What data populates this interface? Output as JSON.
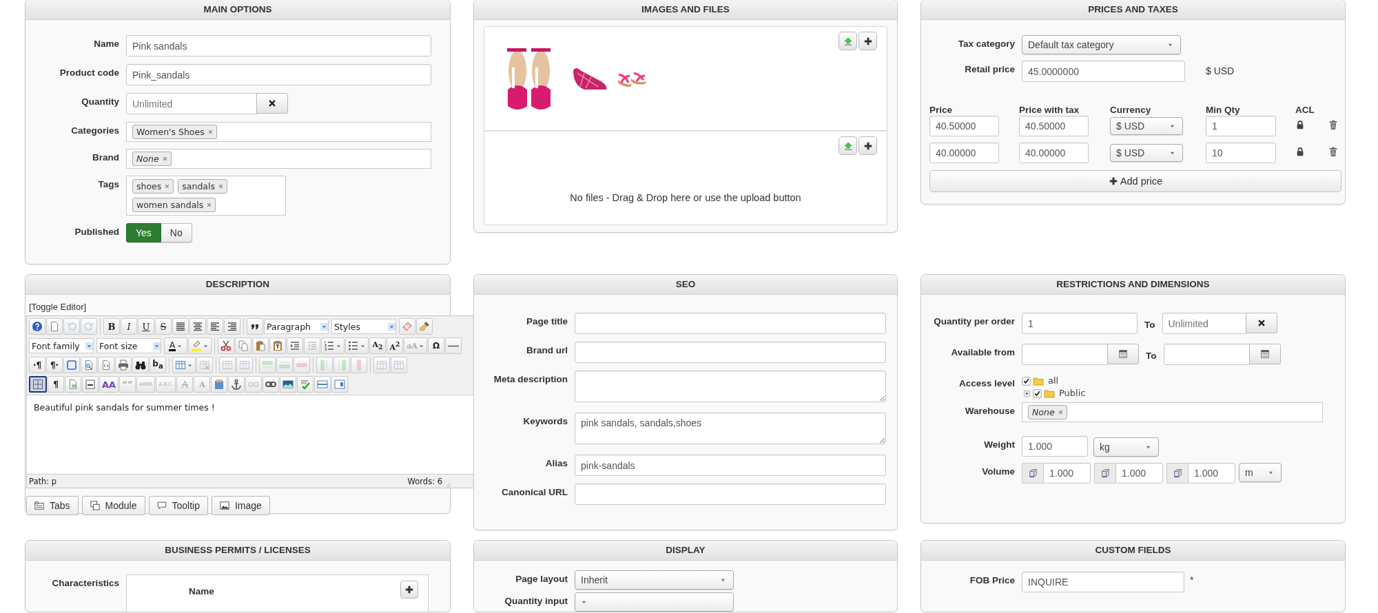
{
  "panels": [
    {
      "kind": "main",
      "title": "MAIN OPTIONS",
      "rows": [
        {
          "kind": "text",
          "label": "Name",
          "value": "Pink sandals"
        },
        {
          "kind": "text",
          "label": "Product code",
          "value": "Pink_sandals"
        },
        {
          "kind": "clearable",
          "label": "Quantity",
          "placeholder": "Unlimited"
        },
        {
          "kind": "tags",
          "label": "Categories",
          "tags": [
            {
              "text": "Women's Shoes",
              "empty": false
            }
          ]
        },
        {
          "kind": "tags",
          "label": "Brand",
          "tags": [
            {
              "text": "None",
              "empty": true
            }
          ]
        },
        {
          "kind": "tags_box",
          "label": "Tags",
          "tags": [
            {
              "text": "shoes",
              "empty": false
            },
            {
              "text": "sandals",
              "empty": false
            },
            {
              "text": "women sandals",
              "empty": false
            }
          ]
        },
        {
          "kind": "toggle",
          "label": "Published",
          "options": [
            {
              "label": "Yes",
              "selected": true
            },
            {
              "label": "No",
              "selected": false
            }
          ]
        }
      ]
    },
    {
      "kind": "images",
      "title": "IMAGES AND FILES",
      "sections": [
        {
          "kind": "images"
        },
        {
          "kind": "files",
          "empty_text": "No files - Drag & Drop here or use the upload button"
        }
      ]
    },
    {
      "kind": "prices",
      "title": "PRICES AND TAXES",
      "rows": [
        {
          "kind": "select",
          "label": "Tax category",
          "value": "Default tax category"
        },
        {
          "kind": "text_suffix",
          "label": "Retail price",
          "value": "45.0000000",
          "suffix": "$ USD"
        }
      ],
      "price_table": {
        "columns": [
          "Price",
          "Price with tax",
          "Currency",
          "Min Qty",
          "ACL"
        ],
        "rows": [
          {
            "price": "40.50000",
            "price_with_tax": "40.50000",
            "currency": "$ USD",
            "min_qty": "1"
          },
          {
            "price": "40.00000",
            "price_with_tax": "40.00000",
            "currency": "$ USD",
            "min_qty": "10"
          }
        ]
      },
      "add_button": "Add price"
    },
    {
      "kind": "description",
      "title": "DESCRIPTION",
      "toggle_link": "[Toggle Editor]",
      "editor": {
        "toolbar": [
          [
            [
              {
                "kind": "icon",
                "dropdown": false,
                "disabled": false,
                "active": false
              },
              {
                "kind": "icon",
                "dropdown": false,
                "disabled": false,
                "active": false
              },
              {
                "kind": "icon",
                "dropdown": false,
                "disabled": true,
                "active": false
              },
              {
                "kind": "icon",
                "dropdown": false,
                "disabled": true,
                "active": false
              }
            ],
            [
              {
                "kind": "glyph",
                "label": "B",
                "dropdown": false,
                "disabled": false,
                "active": false
              },
              {
                "kind": "glyph",
                "label": "I",
                "dropdown": false,
                "disabled": false,
                "active": false
              },
              {
                "kind": "glyph",
                "label": "U",
                "dropdown": false,
                "disabled": false,
                "active": false
              },
              {
                "kind": "glyph",
                "label": "S",
                "dropdown": false,
                "disabled": false,
                "active": false
              },
              {
                "kind": "icon",
                "dropdown": false,
                "disabled": false,
                "active": false
              },
              {
                "kind": "icon",
                "dropdown": false,
                "disabled": false,
                "active": false
              },
              {
                "kind": "icon",
                "dropdown": false,
                "disabled": false,
                "active": false
              },
              {
                "kind": "icon",
                "dropdown": false,
                "disabled": false,
                "active": false
              }
            ],
            [
              {
                "kind": "icon",
                "dropdown": false,
                "disabled": false,
                "active": false
              },
              {
                "kind": "select",
                "value": "Paragraph"
              },
              {
                "kind": "select",
                "value": "Styles"
              },
              {
                "kind": "icon",
                "dropdown": false,
                "disabled": false,
                "active": false
              },
              {
                "kind": "icon",
                "dropdown": false,
                "disabled": false,
                "active": false
              }
            ]
          ],
          [
            [
              {
                "kind": "select",
                "value": "Font family"
              },
              {
                "kind": "select",
                "value": "Font size"
              },
              {
                "kind": "glyph",
                "label": "A",
                "dropdown": true,
                "disabled": false,
                "active": false
              },
              {
                "kind": "icon",
                "dropdown": true,
                "disabled": false,
                "active": false
              }
            ],
            [
              {
                "kind": "icon",
                "dropdown": false,
                "disabled": false,
                "active": false
              },
              {
                "kind": "icon",
                "dropdown": false,
                "disabled": false,
                "active": false
              },
              {
                "kind": "icon",
                "dropdown": false,
                "disabled": false,
                "active": false
              },
              {
                "kind": "icon",
                "dropdown": false,
                "disabled": false,
                "active": false
              },
              {
                "kind": "icon",
                "dropdown": false,
                "disabled": false,
                "active": false
              },
              {
                "kind": "icon",
                "dropdown": false,
                "disabled": true,
                "active": false
              },
              {
                "kind": "icon",
                "dropdown": true,
                "disabled": false,
                "active": false
              },
              {
                "kind": "icon",
                "dropdown": true,
                "disabled": false,
                "active": false
              },
              {
                "kind": "glyph",
                "label": "A$_{2}$",
                "dropdown": false,
                "disabled": false,
                "active": false
              },
              {
                "kind": "glyph",
                "label": "A$^{2}$",
                "dropdown": false,
                "disabled": false,
                "active": false
              },
              {
                "kind": "glyph",
                "label": "aA",
                "dropdown": true,
                "disabled": true,
                "active": false
              },
              {
                "kind": "glyph",
                "label": "Ω",
                "dropdown": false,
                "disabled": false,
                "active": false
              },
              {
                "kind": "icon",
                "dropdown": false,
                "disabled": false,
                "active": false
              }
            ]
          ],
          [
            [
              {
                "kind": "glyph",
                "label": "·¶",
                "dropdown": false,
                "disabled": false,
                "active": false
              },
              {
                "kind": "glyph",
                "label": "¶·",
                "dropdown": false,
                "disabled": false,
                "active": false
              },
              {
                "kind": "icon",
                "dropdown": false,
                "disabled": false,
                "active": false
              },
              {
                "kind": "icon",
                "dropdown": false,
                "disabled": false,
                "active": false
              },
              {
                "kind": "icon",
                "dropdown": false,
                "disabled": false,
                "active": false
              },
              {
                "kind": "icon",
                "dropdown": false,
                "disabled": false,
                "active": false
              },
              {
                "kind": "icon",
                "dropdown": false,
                "disabled": false,
                "active": false
              },
              {
                "kind": "glyph",
                "label": "b$_{a}$",
                "dropdown": false,
                "disabled": false,
                "active": false
              }
            ],
            [
              {
                "kind": "icon",
                "dropdown": true,
                "disabled": false,
                "active": false
              },
              {
                "kind": "icon",
                "dropdown": false,
                "disabled": true,
                "active": false
              }
            ],
            [
              {
                "kind": "icon",
                "dropdown": false,
                "disabled": true,
                "active": false
              },
              {
                "kind": "icon",
                "dropdown": false,
                "disabled": true,
                "active": false
              }
            ],
            [
              {
                "kind": "icon",
                "dropdown": false,
                "disabled": true,
                "active": false
              },
              {
                "kind": "icon",
                "dropdown": false,
                "disabled": true,
                "active": false
              },
              {
                "kind": "icon",
                "dropdown": false,
                "disabled": true,
                "active": false
              }
            ],
            [
              {
                "kind": "icon",
                "dropdown": false,
                "disabled": true,
                "active": false
              },
              {
                "kind": "icon",
                "dropdown": false,
                "disabled": true,
                "active": false
              },
              {
                "kind": "icon",
                "dropdown": false,
                "disabled": true,
                "active": false
              }
            ],
            [
              {
                "kind": "icon",
                "dropdown": false,
                "disabled": true,
                "active": false
              },
              {
                "kind": "icon",
                "dropdown": false,
                "disabled": true,
                "active": false
              }
            ]
          ],
          [
            [
              {
                "kind": "icon",
                "dropdown": false,
                "disabled": false,
                "active": true
              },
              {
                "kind": "glyph",
                "label": "¶",
                "dropdown": false,
                "disabled": false,
                "active": false
              },
              {
                "kind": "icon",
                "dropdown": false,
                "disabled": false,
                "active": false
              },
              {
                "kind": "icon",
                "dropdown": false,
                "disabled": false,
                "active": false
              },
              {
                "kind": "glyph",
                "label": "AA",
                "dropdown": false,
                "disabled": false,
                "active": false
              },
              {
                "kind": "glyph",
                "label": "“”",
                "dropdown": false,
                "disabled": true,
                "active": false
              },
              {
                "kind": "glyph",
                "label": "ABBR",
                "dropdown": false,
                "disabled": true,
                "active": false
              },
              {
                "kind": "glyph",
                "label": "A.B.C.",
                "dropdown": false,
                "disabled": true,
                "active": false
              },
              {
                "kind": "glyph",
                "label": "A",
                "dropdown": false,
                "disabled": true,
                "active": false
              },
              {
                "kind": "glyph",
                "label": "A",
                "dropdown": false,
                "disabled": true,
                "active": false
              },
              {
                "kind": "icon",
                "dropdown": false,
                "disabled": false,
                "active": false
              },
              {
                "kind": "icon",
                "dropdown": false,
                "disabled": false,
                "active": false
              },
              {
                "kind": "icon",
                "dropdown": false,
                "disabled": true,
                "active": false
              },
              {
                "kind": "icon",
                "dropdown": false,
                "disabled": false,
                "active": false
              },
              {
                "kind": "icon",
                "dropdown": false,
                "disabled": false,
                "active": false
              },
              {
                "kind": "icon",
                "dropdown": false,
                "disabled": false,
                "active": false
              },
              {
                "kind": "icon",
                "dropdown": false,
                "disabled": false,
                "active": false
              },
              {
                "kind": "icon",
                "dropdown": false,
                "disabled": false,
                "active": false
              }
            ]
          ]
        ],
        "content": "Beautiful pink sandals for summer times !",
        "path": "Path: p",
        "words": "Words: 6"
      },
      "buttons": [
        {
          "label": "Tabs"
        },
        {
          "label": "Module"
        },
        {
          "label": "Tooltip"
        },
        {
          "label": "Image"
        }
      ]
    },
    {
      "kind": "seo",
      "title": "SEO",
      "rows": [
        {
          "kind": "text",
          "label": "Page title"
        },
        {
          "kind": "text",
          "label": "Brand url"
        },
        {
          "kind": "textarea",
          "label": "Meta description"
        },
        {
          "kind": "textarea",
          "label": "Keywords",
          "value": "pink sandals, sandals,shoes"
        },
        {
          "kind": "text",
          "label": "Alias",
          "value": "pink-sandals"
        },
        {
          "kind": "text",
          "label": "Canonical URL"
        }
      ]
    },
    {
      "kind": "restrictions",
      "title": "RESTRICTIONS AND DIMENSIONS",
      "rows": [
        {
          "kind": "range",
          "label": "Quantity per order",
          "value": "1",
          "to_label": "To",
          "to_placeholder": "Unlimited"
        },
        {
          "kind": "date_range",
          "label": "Available from",
          "to_label": "To"
        },
        {
          "kind": "tree",
          "label": "Access level",
          "items": [
            {
              "label": "all",
              "checked": true,
              "expanded": true,
              "children": [
                {
                  "label": "Public",
                  "checked": true,
                  "expanded": false
                }
              ]
            }
          ]
        },
        {
          "kind": "tags",
          "label": "Warehouse",
          "tags": [
            {
              "text": "None",
              "empty": true
            }
          ]
        },
        {
          "kind": "unit",
          "label": "Weight",
          "value": "1.000",
          "unit": "kg"
        },
        {
          "kind": "volume",
          "label": "Volume",
          "values": [
            "1.000",
            "1.000",
            "1.000"
          ],
          "unit": "m"
        }
      ]
    },
    {
      "kind": "permits",
      "title": "BUSINESS PERMITS / LICENSES",
      "rows": [
        {
          "kind": "table_box",
          "label": "Characteristics",
          "column": "Name"
        }
      ]
    },
    {
      "kind": "display",
      "title": "DISPLAY",
      "rows": [
        {
          "kind": "select",
          "label": "Page layout",
          "value": "Inherit"
        },
        {
          "kind": "select",
          "label": "Quantity input"
        }
      ]
    },
    {
      "kind": "custom",
      "title": "CUSTOM FIELDS",
      "rows": [
        {
          "kind": "text_suffix",
          "label": "FOB Price",
          "value": "INQUIRE",
          "suffix": "*"
        }
      ]
    }
  ]
}
